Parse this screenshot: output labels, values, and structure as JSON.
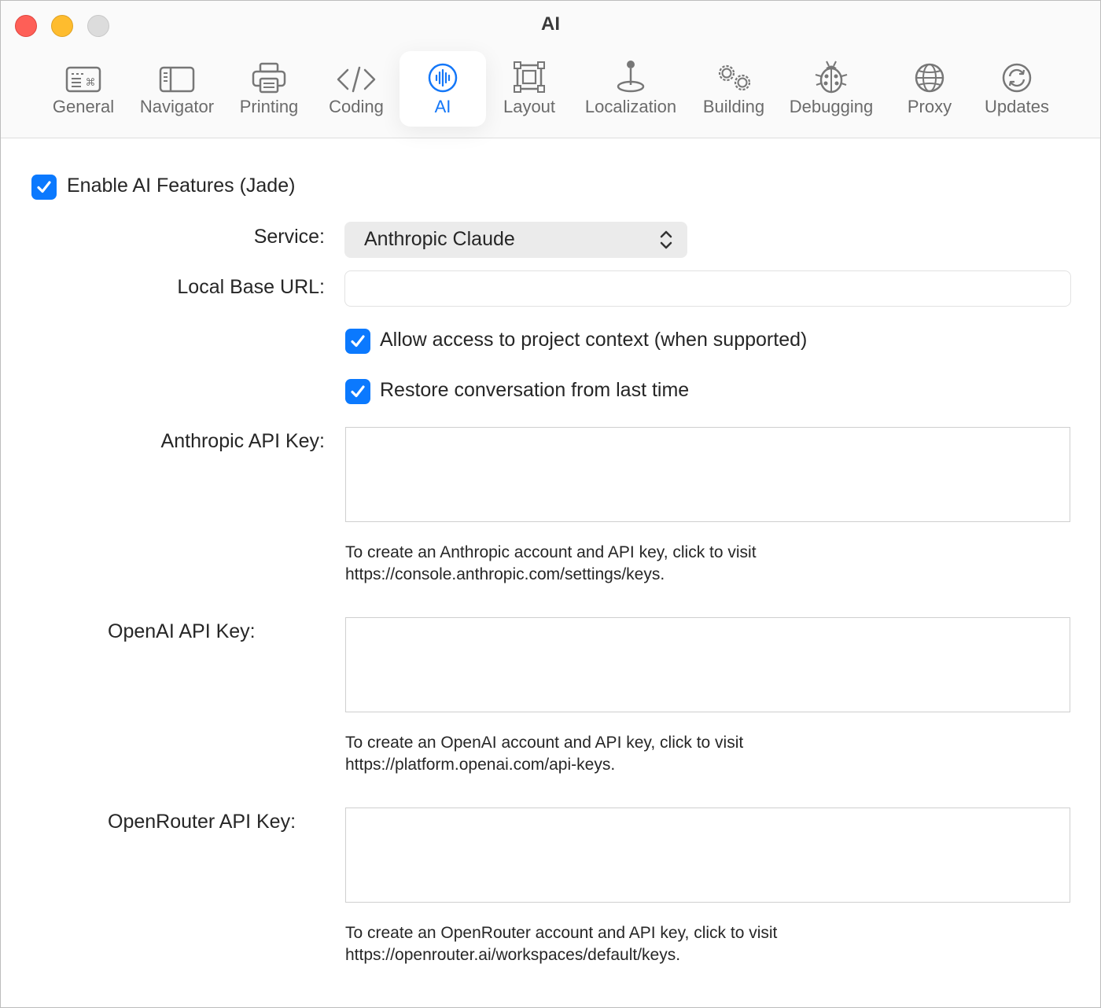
{
  "window": {
    "title": "AI"
  },
  "toolbar": {
    "tabs": [
      {
        "label": "General",
        "icon": "keyboard-icon"
      },
      {
        "label": "Navigator",
        "icon": "sidebar-icon"
      },
      {
        "label": "Printing",
        "icon": "printer-icon"
      },
      {
        "label": "Coding",
        "icon": "code-brackets-icon"
      },
      {
        "label": "AI",
        "icon": "waveform-icon",
        "selected": true
      },
      {
        "label": "Layout",
        "icon": "layout-frame-icon"
      },
      {
        "label": "Localization",
        "icon": "joystick-icon"
      },
      {
        "label": "Building",
        "icon": "gears-icon"
      },
      {
        "label": "Debugging",
        "icon": "ladybug-icon"
      },
      {
        "label": "Proxy",
        "icon": "globe-icon"
      },
      {
        "label": "Updates",
        "icon": "refresh-icon"
      }
    ]
  },
  "settings": {
    "enable_ai": {
      "label": "Enable AI Features (Jade)",
      "checked": true
    },
    "service": {
      "label": "Service:",
      "value": "Anthropic Claude"
    },
    "local_base_url": {
      "label": "Local Base URL:",
      "value": ""
    },
    "project_context": {
      "label": "Allow access to project context (when supported)",
      "checked": true
    },
    "restore_conversation": {
      "label": "Restore conversation from last time",
      "checked": true
    },
    "anthropic": {
      "label": "Anthropic API Key:",
      "value": "",
      "help_line1": "To create an Anthropic account and API key, click to visit",
      "help_line2": "https://console.anthropic.com/settings/keys."
    },
    "openai": {
      "label": "OpenAI API Key:",
      "value": "",
      "help_line1": "To create an OpenAI account and API key, click to visit",
      "help_line2": "https://platform.openai.com/api-keys."
    },
    "openrouter": {
      "label": "OpenRouter API Key:",
      "value": "",
      "help_line1": "To create an OpenRouter account and API key, click to visit",
      "help_line2": "https://openrouter.ai/workspaces/default/keys."
    }
  },
  "colors": {
    "accent": "#0b79fe",
    "tab_selected": "#1477f8"
  }
}
